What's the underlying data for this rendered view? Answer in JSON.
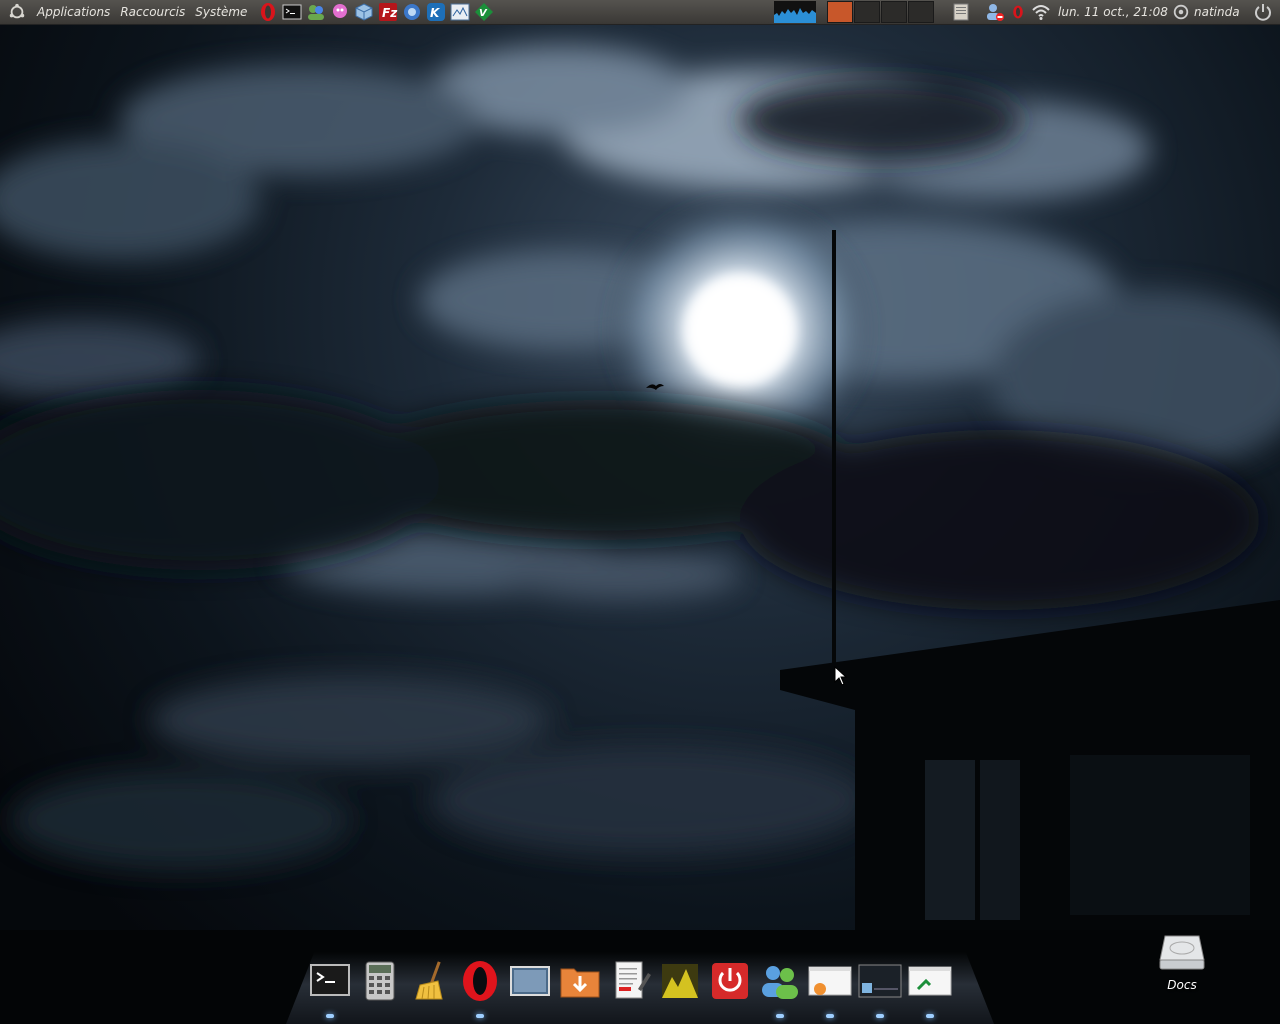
{
  "top_panel": {
    "menus": [
      "Applications",
      "Raccourcis",
      "Système"
    ],
    "launchers": [
      "opera-icon",
      "terminal-icon",
      "pidgin-icon",
      "octopus-icon",
      "virtualbox-icon",
      "filezilla-icon",
      "browser-icon",
      "kde-icon",
      "monitor-icon",
      "vim-icon"
    ],
    "workspace_count": 4,
    "active_workspace": 1,
    "clock": "lun. 11 oct., 21:08",
    "user": "natinda"
  },
  "dock": {
    "items": [
      {
        "name": "terminal"
      },
      {
        "name": "calculator"
      },
      {
        "name": "broom"
      },
      {
        "name": "opera"
      },
      {
        "name": "show-desktop"
      },
      {
        "name": "downloads-folder"
      },
      {
        "name": "text-editor"
      },
      {
        "name": "image-viewer"
      },
      {
        "name": "power"
      },
      {
        "name": "messenger"
      },
      {
        "name": "window-thumbnail-1"
      },
      {
        "name": "window-thumbnail-2"
      },
      {
        "name": "window-thumbnail-3"
      }
    ]
  },
  "desktop": {
    "icons": [
      {
        "label": "Docs"
      }
    ]
  },
  "colors": {
    "panel": "#45433f",
    "active_workspace": "#c8572a",
    "accent": "#9ecfff"
  }
}
